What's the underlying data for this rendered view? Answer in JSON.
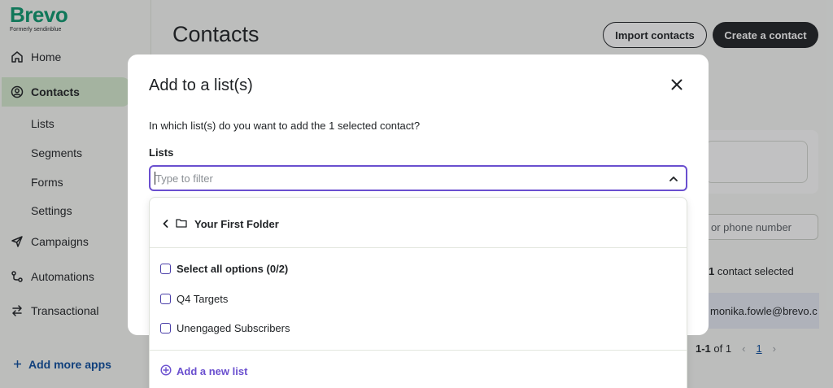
{
  "brand": {
    "name": "Brevo",
    "subtitle": "Formerly sendinblue",
    "accent": "#0b996e"
  },
  "sidebar": {
    "items": [
      {
        "label": "Home",
        "icon": "home-icon"
      },
      {
        "label": "Contacts",
        "icon": "user-circle-icon",
        "active": true
      },
      {
        "label": "Campaigns",
        "icon": "send-icon"
      },
      {
        "label": "Automations",
        "icon": "automation-icon"
      },
      {
        "label": "Transactional",
        "icon": "transfer-icon"
      }
    ],
    "sub_items": [
      "Lists",
      "Segments",
      "Forms",
      "Settings"
    ],
    "add_apps": "Add more apps"
  },
  "header": {
    "title": "Contacts",
    "import_label": "Import contacts",
    "create_label": "Create a contact"
  },
  "background": {
    "search_placeholder": "or phone number",
    "selected_count": "1",
    "selected_text": " contact selected",
    "row_email": "monika.fowle@brevo.c",
    "pager_range": "1-1",
    "pager_of": " of 1",
    "pager_current": "1"
  },
  "modal": {
    "title": "Add to a list(s)",
    "question": "In which list(s) do you want to add the 1 selected contact?",
    "lists_label": "Lists",
    "filter_placeholder": "Type to filter",
    "dropdown": {
      "folder": "Your First Folder",
      "select_all": "Select all options (0/2)",
      "options": [
        "Q4 Targets",
        "Unengaged Subscribers"
      ],
      "add_new": "Add a new list"
    },
    "focus_color": "#6a4fcf"
  }
}
